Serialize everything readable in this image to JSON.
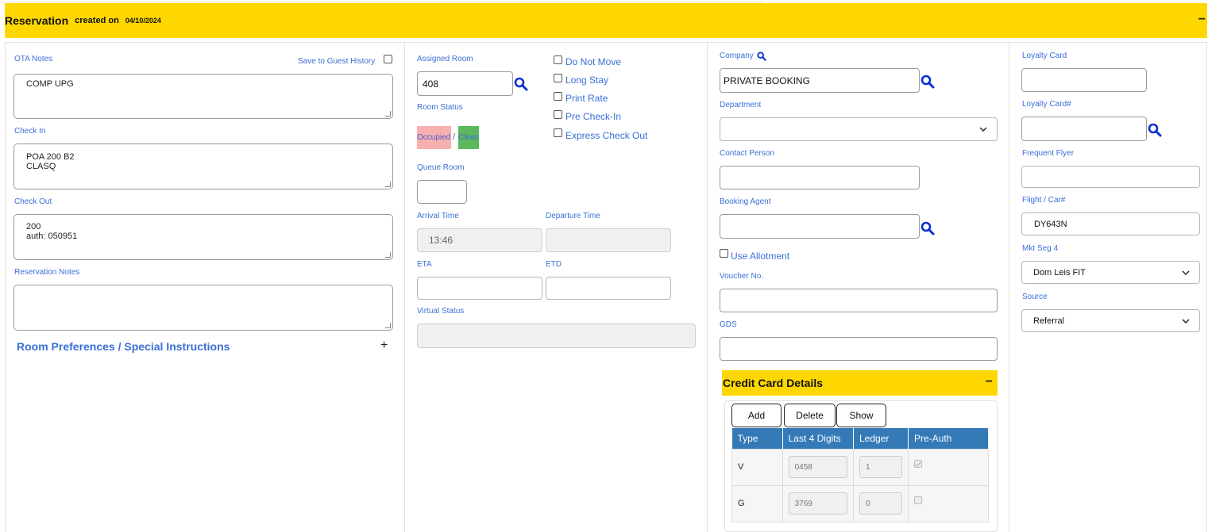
{
  "header": {
    "title": "Reservation",
    "created_label": "created on",
    "created_date": "04/10/2024",
    "collapse_icon": "−"
  },
  "col1": {
    "ota_notes_label": "OTA Notes",
    "save_guest_history_label": "Save to Guest History",
    "ota_notes_value": "COMP UPG",
    "check_in_label": "Check In",
    "check_in_value": "POA 200 B2\nCLASQ",
    "check_out_label": "Check Out",
    "check_out_value": "200\nauth: 050951",
    "reservation_notes_label": "Reservation Notes",
    "reservation_notes_value": "",
    "room_prefs_label": "Room Preferences / Special Instructions",
    "room_prefs_icon": "+"
  },
  "col2": {
    "assigned_room_label": "Assigned Room",
    "assigned_room_value": "408",
    "room_status_label": "Room Status",
    "occupied_label": "Occupied",
    "separator": "/",
    "clean_label": "Clean",
    "queue_room_label": "Queue Room",
    "arrival_time_label": "Arrival Time",
    "arrival_time_value": "13:46",
    "departure_time_label": "Departure Time",
    "eta_label": "ETA",
    "etd_label": "ETD",
    "virtual_status_label": "Virtual Status",
    "checkboxes": [
      "Do Not Move",
      "Long Stay",
      "Print Rate",
      "Pre Check-In",
      "Express Check Out"
    ],
    "occupied_color": "#f7b0b0",
    "clean_color": "#5cb85c"
  },
  "col3": {
    "company_label": "Company",
    "company_value": "PRIVATE BOOKING",
    "department_label": "Department",
    "contact_person_label": "Contact Person",
    "booking_agent_label": "Booking Agent",
    "use_allotment_label": "Use Allotment",
    "voucher_label": "Voucher No.",
    "gds_label": "GDS"
  },
  "col4": {
    "loyalty_card_label": "Loyalty Card",
    "loyalty_card_no_label": "Loyalty Card#",
    "frequent_flyer_label": "Frequent Flyer",
    "flight_car_label": "Flight / Car#",
    "flight_car_value": "DY643N",
    "mkt_seg_label": "Mkt Seg 4",
    "mkt_seg_value": "Dom Leis FIT",
    "source_label": "Source",
    "source_value": "Referral"
  },
  "credit_card": {
    "title": "Credit Card Details",
    "collapse_icon": "−",
    "buttons": {
      "add": "Add",
      "delete": "Delete",
      "show": "Show"
    },
    "columns": [
      "Type",
      "Last 4 Digits",
      "Ledger",
      "Pre-Auth"
    ],
    "rows": [
      {
        "type": "V",
        "last4": "0458",
        "ledger": "1",
        "preauth": true
      },
      {
        "type": "G",
        "last4": "3769",
        "ledger": "0",
        "preauth": false
      }
    ],
    "header_color": "#337ab7"
  },
  "theme": {
    "accent": "#ffd700",
    "label": "#3a6fd6",
    "icon": "#0b2fd1"
  }
}
